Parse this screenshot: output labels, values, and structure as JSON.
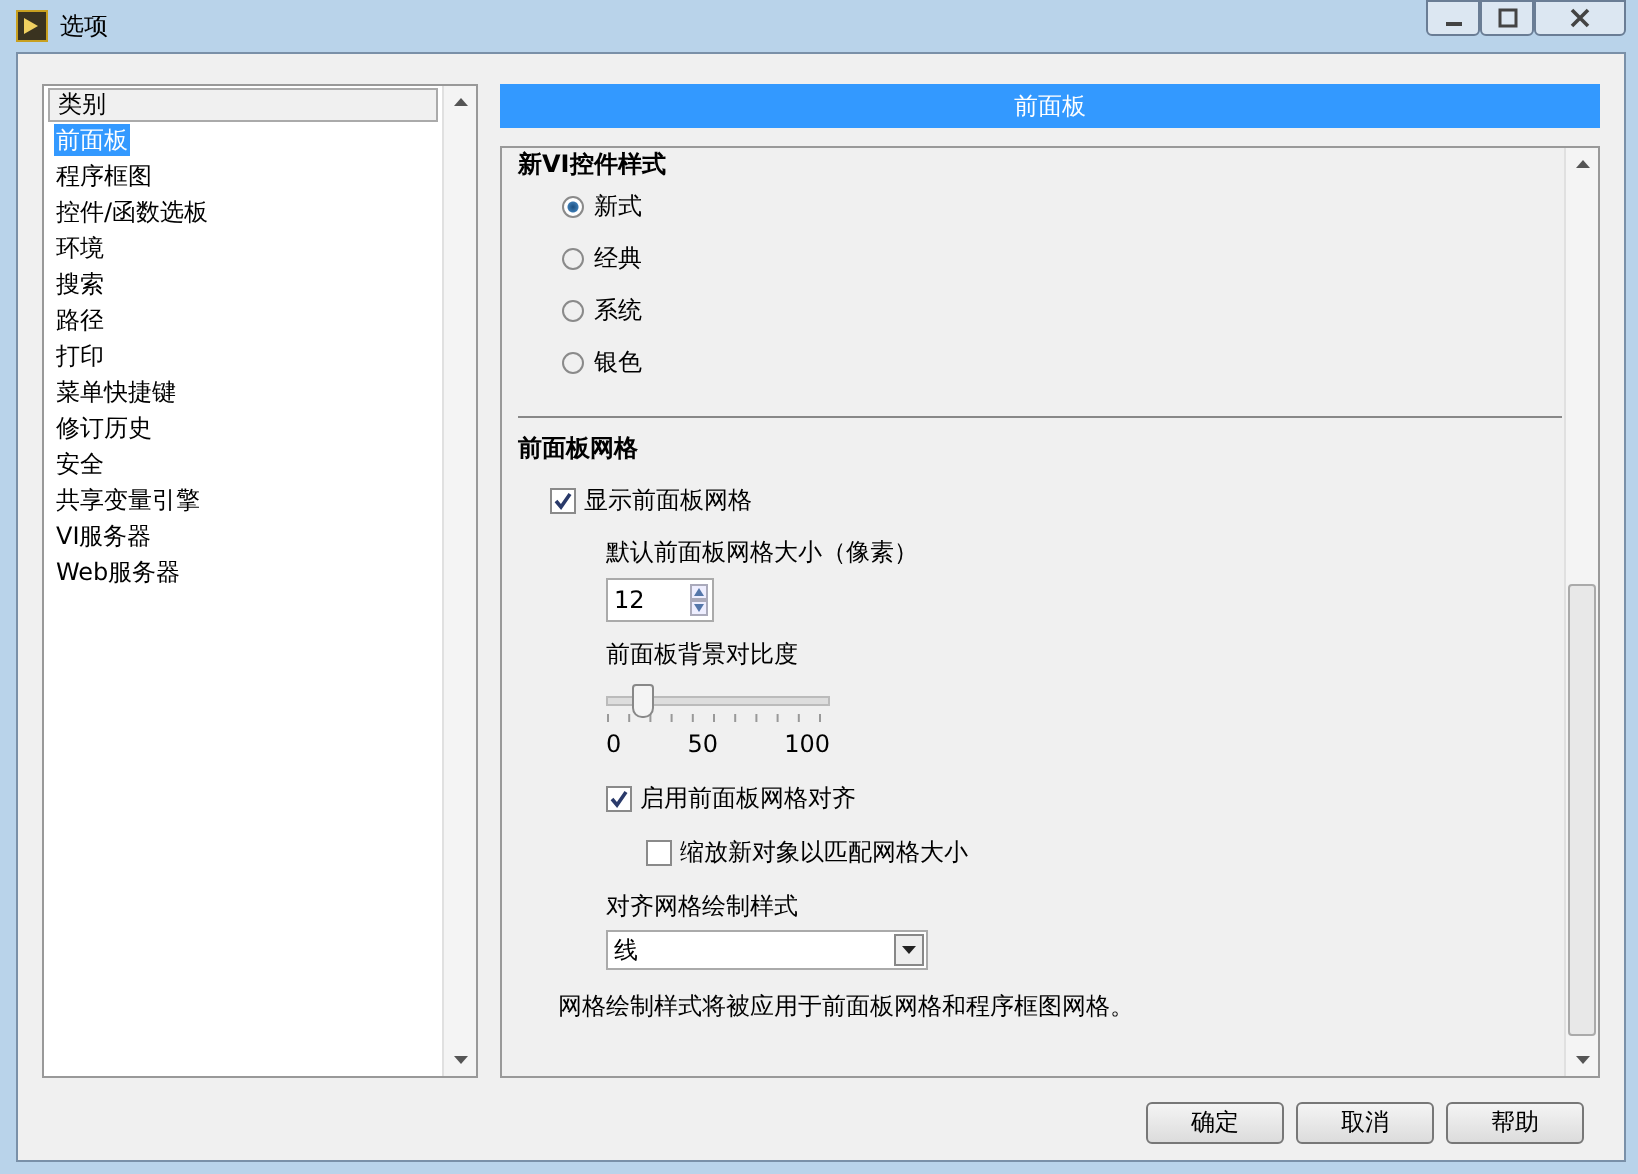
{
  "window": {
    "title": "选项"
  },
  "sidebar": {
    "header": "类别",
    "items": [
      {
        "label": "前面板",
        "selected": true
      },
      {
        "label": "程序框图",
        "selected": false
      },
      {
        "label": "控件/函数选板",
        "selected": false
      },
      {
        "label": "环境",
        "selected": false
      },
      {
        "label": "搜索",
        "selected": false
      },
      {
        "label": "路径",
        "selected": false
      },
      {
        "label": "打印",
        "selected": false
      },
      {
        "label": "菜单快捷键",
        "selected": false
      },
      {
        "label": "修订历史",
        "selected": false
      },
      {
        "label": "安全",
        "selected": false
      },
      {
        "label": "共享变量引擎",
        "selected": false
      },
      {
        "label": "VI服务器",
        "selected": false
      },
      {
        "label": "Web服务器",
        "selected": false
      }
    ]
  },
  "panel": {
    "title": "前面板",
    "style_section": {
      "heading": "新VI控件样式",
      "options": [
        {
          "label": "新式",
          "selected": true
        },
        {
          "label": "经典",
          "selected": false
        },
        {
          "label": "系统",
          "selected": false
        },
        {
          "label": "银色",
          "selected": false
        }
      ]
    },
    "grid_section": {
      "heading": "前面板网格",
      "show_grid": {
        "label": "显示前面板网格",
        "checked": true
      },
      "grid_size": {
        "label": "默认前面板网格大小（像素）",
        "value": "12"
      },
      "contrast": {
        "label": "前面板背景对比度",
        "level": 0.12,
        "tick_labels": [
          "0",
          "50",
          "100"
        ]
      },
      "snap": {
        "label": "启用前面板网格对齐",
        "checked": true
      },
      "scale": {
        "label": "缩放新对象以匹配网格大小",
        "checked": false
      },
      "draw_style": {
        "label": "对齐网格绘制样式",
        "value": "线"
      },
      "note": "网格绘制样式将被应用于前面板网格和程序框图网格。"
    }
  },
  "buttons": [
    "确定",
    "取消",
    "帮助"
  ]
}
